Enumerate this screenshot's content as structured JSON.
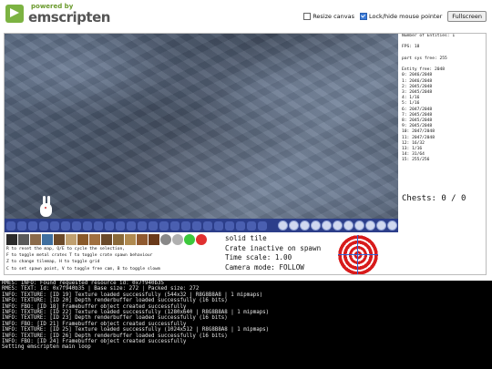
{
  "header": {
    "logo_powered": "powered by",
    "logo_name": "emscripten",
    "resize_canvas_label": "Resize canvas",
    "resize_canvas_checked": false,
    "lock_mouse_label": "Lock/hide mouse pointer",
    "lock_mouse_checked": true,
    "fullscreen_label": "Fullscreen"
  },
  "panel": {
    "lines": [
      "Number of Entities: 1",
      "",
      "FPS: 18",
      "",
      "part sys free: 255",
      "",
      "Entity free: 2048",
      "0: 2046/2048",
      "1: 2046/2048",
      "2: 2045/2048",
      "3: 2045/2048",
      "4: 1/16",
      "5: 1/16",
      "6: 2047/2048",
      "7: 2045/2048",
      "8: 2045/2048",
      "9: 2045/2048",
      "10: 2047/2048",
      "11: 2047/2048",
      "12: 16/32",
      "13: 1/16",
      "14: 31/64",
      "15: 255/256"
    ],
    "chests": "Chests: 0 / 0"
  },
  "bottom": {
    "palette_colors": [
      "#2b2b2b",
      "#5a5a5a",
      "#8a6a4a",
      "#3f6f9f",
      "#6b4a2a",
      "#c0a070",
      "#8a5a2a",
      "#a07040",
      "#6a4a2a",
      "#8a6a3a",
      "#b08a50",
      "#905a30",
      "#6a3a1a",
      "#888888",
      "#b0b0b0",
      "#3cc83c",
      "#e03030"
    ],
    "help_lines": [
      "R to reset the map, Q/E to cycle the selection,",
      "F to toggle metal crates T to toggle crate spawn behaviour",
      "Z to change tilemap, H to toggle grid",
      "C to set spawn point, V to toggle free cam, B to toggle slowm"
    ],
    "status_lines": [
      "solid tile",
      "Crate inactive on spawn",
      "Time scale: 1.00",
      "Camera mode: FOLLOW"
    ]
  },
  "console": {
    "lines": [
      "RMES: INFO: Found requested resource id: 0x7f940b35",
      "RMES: TEXT: Id: 0x7f940b35 | Base size: 272 | Packed size: 272",
      "INFO: TEXTURE: [ID 19] Texture loaded successfully (544x32 | R8G8B8A8 | 1 mipmaps)",
      "INFO: TEXTURE: [ID 20] Depth renderbuffer loaded successfully (16 bits)",
      "INFO: FBO: [ID 18] Framebuffer object created successfully",
      "INFO: TEXTURE: [ID 22] Texture loaded successfully (1280x640 | R8G8B8A8 | 1 mipmaps)",
      "INFO: TEXTURE: [ID 23] Depth renderbuffer loaded successfully (16 bits)",
      "INFO: FBO: [ID 21] Framebuffer object created successfully",
      "INFO: TEXTURE: [ID 25] Texture loaded successfully (1024x512 | R8G8B8A8 | 1 mipmaps)",
      "INFO: TEXTURE: [ID 26] Depth renderbuffer loaded successfully (16 bits)",
      "INFO: FBO: [ID 24] Framebuffer object created successfully",
      "Setting emscripten main loop"
    ]
  }
}
